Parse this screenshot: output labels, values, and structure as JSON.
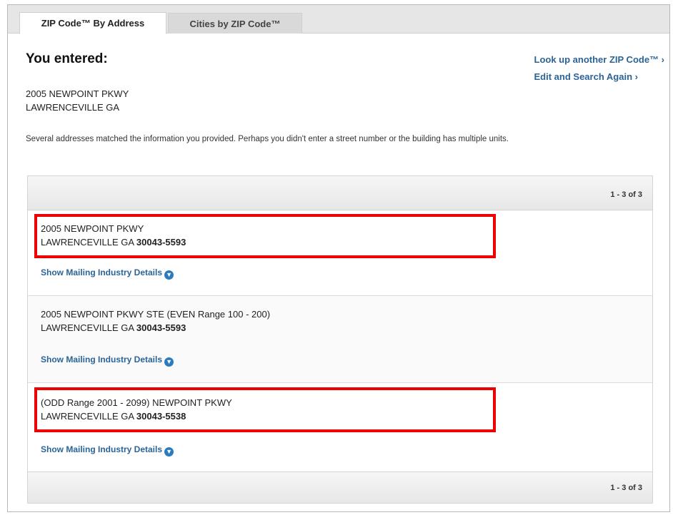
{
  "tabs": [
    {
      "label": "ZIP Code™ By Address",
      "active": true
    },
    {
      "label": "Cities by ZIP Code™",
      "active": false
    }
  ],
  "heading": "You entered:",
  "side_links": {
    "lookup_another": "Look up another ZIP Code™ ›",
    "edit_search": "Edit and Search Again ›"
  },
  "entered_address": {
    "line1": "2005 NEWPOINT PKWY",
    "line2": "LAWRENCEVILLE GA"
  },
  "notice": "Several addresses matched the information you provided. Perhaps you didn't enter a street number or the building has multiple units.",
  "pagination": {
    "header_range": "1 - 3 of 3",
    "footer_range": "1 - 3 of 3"
  },
  "results": [
    {
      "street": "2005 NEWPOINT PKWY",
      "city_state": "LAWRENCEVILLE GA",
      "zip": "30043-5593",
      "details_label": "Show Mailing Industry Details"
    },
    {
      "street": "2005 NEWPOINT PKWY STE (EVEN Range 100 - 200)",
      "city_state": "LAWRENCEVILLE GA",
      "zip": "30043-5593",
      "details_label": "Show Mailing Industry Details"
    },
    {
      "street": "(ODD Range 2001 - 2099) NEWPOINT PKWY",
      "city_state": "LAWRENCEVILLE GA",
      "zip": "30043-5538",
      "details_label": "Show Mailing Industry Details"
    }
  ],
  "colors": {
    "link": "#2a6496",
    "highlight": "#ee0000",
    "chevron_icon": "#2a7bc0"
  },
  "icons": {
    "details_toggle": "chevron-down-circle-icon"
  }
}
